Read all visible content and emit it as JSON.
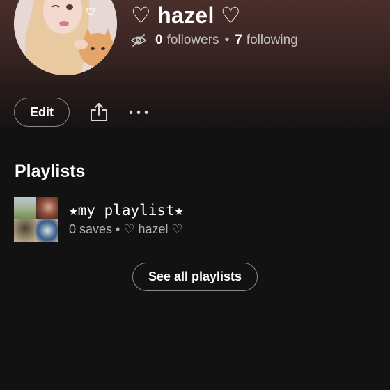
{
  "profile": {
    "display_name": "♡ hazel ♡",
    "followers_count": "0",
    "followers_label": "followers",
    "separator": "•",
    "following_count": "7",
    "following_label": "following",
    "avatar_icon": "profile-avatar-image",
    "private_icon": "eye-off-icon"
  },
  "actions": {
    "edit_label": "Edit",
    "share_icon": "share-icon",
    "more_icon": "more-options-icon"
  },
  "playlists": {
    "section_title": "Playlists",
    "items": [
      {
        "title": "★my playlist★",
        "subtitle": "0 saves • ♡ hazel ♡"
      }
    ],
    "see_all_label": "See all playlists"
  },
  "colors": {
    "background": "#121212",
    "header_gradient_top": "#4a2f2c",
    "secondary_text": "#b3b3b3",
    "button_border": "#8a8a8a"
  }
}
